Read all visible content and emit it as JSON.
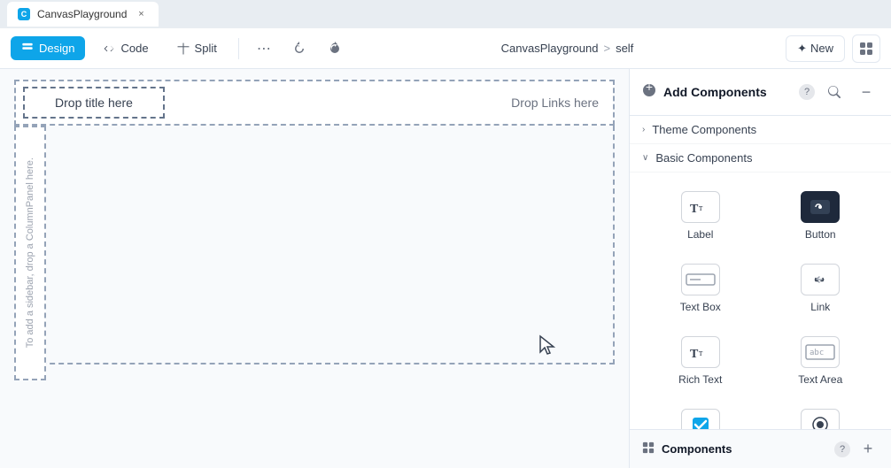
{
  "tab": {
    "favicon_label": "C",
    "title": "CanvasPlayground",
    "close_label": "×"
  },
  "toolbar": {
    "design_label": "Design",
    "code_label": "Code",
    "split_label": "Split",
    "more_label": "⋯",
    "undo_label": "↩",
    "redo_label": "↪",
    "breadcrumb_app": "CanvasPlayground",
    "breadcrumb_sep": ">",
    "breadcrumb_page": "self",
    "new_label": "✦ New",
    "grid_label": "⊞"
  },
  "canvas": {
    "nav_title_drop": "Drop title here",
    "nav_links_drop": "Drop Links here",
    "sidebar_text": "To add a sidebar, drop a ColumnPanel here."
  },
  "panel": {
    "title": "Add Components",
    "help_label": "?",
    "search_label": "🔍",
    "collapse_label": "−",
    "theme_section": {
      "chevron": "›",
      "label": "Theme Components"
    },
    "basic_section": {
      "chevron": "∨",
      "label": "Basic Components"
    },
    "components": [
      {
        "id": "label",
        "icon": "Tт",
        "label": "Label",
        "dark": false
      },
      {
        "id": "button",
        "icon": "👆",
        "label": "Button",
        "dark": true
      },
      {
        "id": "textbox",
        "icon": "▬",
        "label": "Text Box",
        "dark": false
      },
      {
        "id": "link",
        "icon": "🔗",
        "label": "Link",
        "dark": false
      },
      {
        "id": "richtext",
        "icon": "Tт",
        "label": "Rich Text",
        "dark": false
      },
      {
        "id": "textarea",
        "icon": "abc",
        "label": "Text Area",
        "dark": false
      },
      {
        "id": "checkbox",
        "icon": "✓",
        "label": "",
        "dark": false
      },
      {
        "id": "radio",
        "icon": "◉",
        "label": "",
        "dark": false
      }
    ]
  },
  "bottom_panel": {
    "title": "Components",
    "help_label": "?",
    "add_label": "+"
  }
}
